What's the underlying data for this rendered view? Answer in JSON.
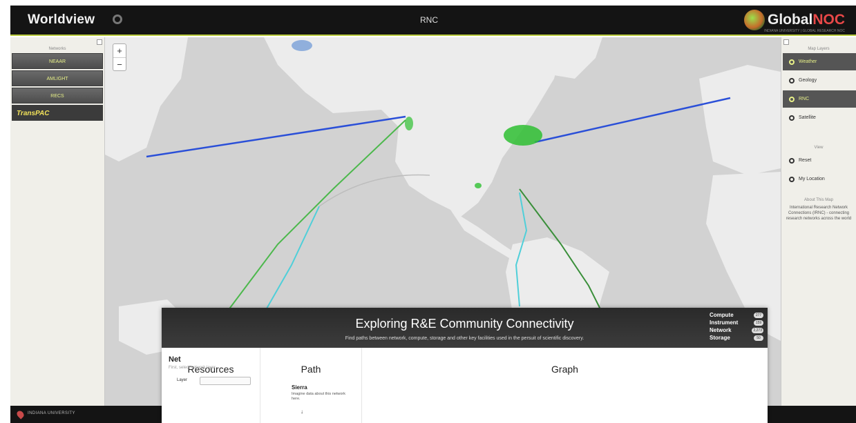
{
  "header": {
    "app_title": "Worldview",
    "center_title": "RNC",
    "brand_name_a": "Global",
    "brand_name_b": "NOC",
    "brand_sub": "INDIANA UNIVERSITY | GLOBAL RESEARCH NOC"
  },
  "left_panel": {
    "heading": "Networks",
    "items": [
      {
        "label": "NEAAR"
      },
      {
        "label": "AMLIGHT"
      },
      {
        "label": "RECS"
      },
      {
        "label": "TransPAC"
      }
    ]
  },
  "zoom": {
    "in_label": "+",
    "out_label": "−"
  },
  "right_panel": {
    "heading": "Map Layers",
    "items": [
      {
        "label": "Weather",
        "active": true
      },
      {
        "label": "Geology",
        "active": false
      },
      {
        "label": "RNC",
        "active": true
      },
      {
        "label": "Satellite",
        "active": false
      }
    ],
    "view_heading": "View",
    "view_items": [
      {
        "label": "Reset"
      },
      {
        "label": "My Location"
      }
    ],
    "note_heading": "About This Map",
    "note_text": "International Research Network Connections (IRNC) - connecting research networks across the world"
  },
  "bottom_bar": {
    "text": "INDIANA UNIVERSITY"
  },
  "modal": {
    "title": "Exploring R&E Community Connectivity",
    "subtitle": "Find paths between network, compute, storage and other key facilities used in the persuit of scientific discovery.",
    "counts": [
      {
        "label": "Compute",
        "value": "277"
      },
      {
        "label": "Instrument",
        "value": "159"
      },
      {
        "label": "Network",
        "value": "2,273"
      },
      {
        "label": "Storage",
        "value": "50"
      }
    ],
    "resources": {
      "heading": "Resources",
      "net_title": "Net",
      "net_hint": "First, select network layer",
      "layer_label": "Layer"
    },
    "path": {
      "heading": "Path",
      "name": "Sierra",
      "description": "Imagine data about this network here.",
      "arrow": "↓"
    },
    "graph": {
      "heading": "Graph"
    }
  },
  "colors": {
    "accent": "#e8f188",
    "link_blue": "#2a4fd8",
    "link_green": "#4cb84c",
    "link_cyan": "#4fcfd9",
    "site_green": "#2fc032"
  }
}
